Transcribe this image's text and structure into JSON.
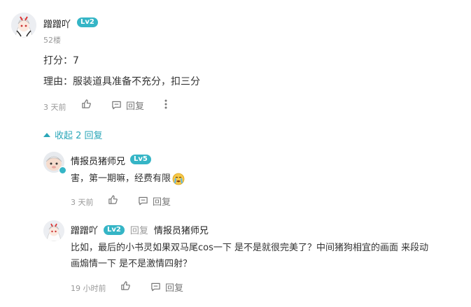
{
  "colors": {
    "accent": "#2aa6b8",
    "level_badge": "#35b5c6",
    "muted": "#999999"
  },
  "main_comment": {
    "user": "蹭蹭吖",
    "level": "Lv2",
    "floor": "52楼",
    "lines": [
      "打分：7",
      "理由：服装道具准备不充分，扣三分"
    ],
    "time": "3 天前",
    "reply_label": "回复"
  },
  "collapse_label": "收起 2 回复",
  "replies": [
    {
      "user": "情报员猪师兄",
      "level": "Lv5",
      "text": "害，第一期嘛，经费有限",
      "emoji": "crying-emoji",
      "time": "3 天前",
      "reply_label": "回复"
    },
    {
      "user": "蹭蹭吖",
      "level": "Lv2",
      "reply_word": "回复",
      "target": "情报员猪师兄",
      "text_line1": "比如，最后的小书灵如果双马尾cos一下 是不是就很完美了？中间猪狗相宜的画面 来段动",
      "text_line2": "画煽情一下 是不是激情四射？",
      "time": "19 小时前",
      "reply_label": "回复"
    }
  ],
  "icons": {
    "like": "thumbs-up-icon",
    "reply": "comment-icon",
    "more": "more-vertical-icon",
    "collapse": "caret-up-icon"
  }
}
